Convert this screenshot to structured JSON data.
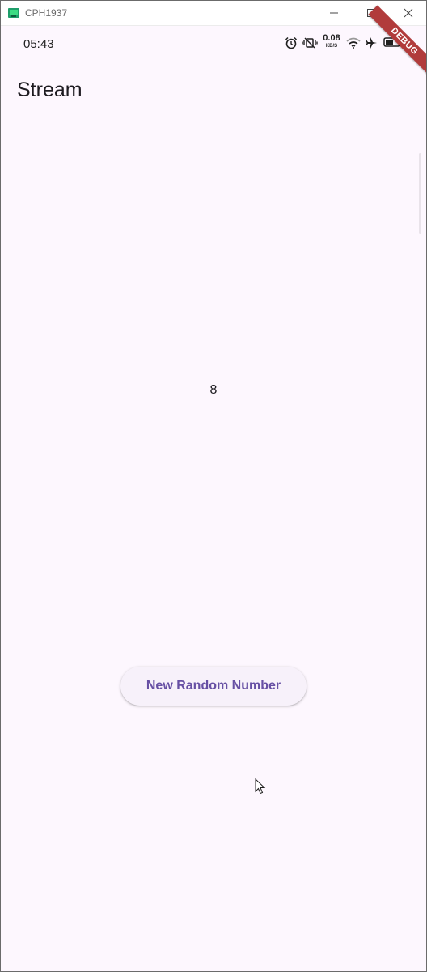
{
  "window": {
    "title": "CPH1937",
    "icon": "android-emulator-icon",
    "controls": [
      "minimize-icon",
      "maximize-icon",
      "close-icon"
    ]
  },
  "status_bar": {
    "time": "05:43",
    "net_speed_value": "0.08",
    "net_speed_unit": "KB/S",
    "icons": [
      "alarm-icon",
      "vibrate-icon",
      "wifi-icon",
      "airplane-icon",
      "battery-icon"
    ]
  },
  "debug_banner": "DEBUG",
  "app_bar": {
    "title": "Stream"
  },
  "content": {
    "stream_value": "8",
    "button_label": "New Random Number"
  },
  "colors": {
    "background": "#fdf7fe",
    "primary": "#6750a4",
    "debug_banner": "#b13b3b",
    "button_surface": "#f7f1fa"
  }
}
